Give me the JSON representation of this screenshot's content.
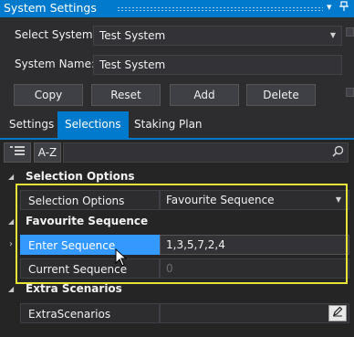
{
  "window": {
    "title": "System Settings"
  },
  "form": {
    "select_system_label": "Select System:",
    "select_system_value": "Test System",
    "system_name_label": "System Name:",
    "system_name_value": "Test System"
  },
  "buttons": {
    "copy": "Copy",
    "reset": "Reset",
    "add": "Add",
    "delete": "Delete"
  },
  "tabs": [
    {
      "label": "Settings",
      "active": false
    },
    {
      "label": "Selections",
      "active": true
    },
    {
      "label": "Staking Plan",
      "active": false
    }
  ],
  "toolbar": {
    "sort_label": "A-Z",
    "search_value": ""
  },
  "grid": {
    "cat_selection_options": "Selection Options",
    "row_selection_options": {
      "name": "Selection Options",
      "value": "Favourite Sequence"
    },
    "cat_favourite_sequence": "Favourite Sequence",
    "row_enter_sequence": {
      "name": "Enter Sequence",
      "value": "1,3,5,7,2,4"
    },
    "row_current_sequence": {
      "name": "Current Sequence",
      "value": "0"
    },
    "cat_extra_scenarios": "Extra Scenarios",
    "row_extra_scenarios": {
      "name": "ExtraScenarios",
      "value": ""
    }
  },
  "colors": {
    "accent": "#007acc",
    "highlight_border": "#e8e338",
    "selected_row": "#3399ff"
  }
}
